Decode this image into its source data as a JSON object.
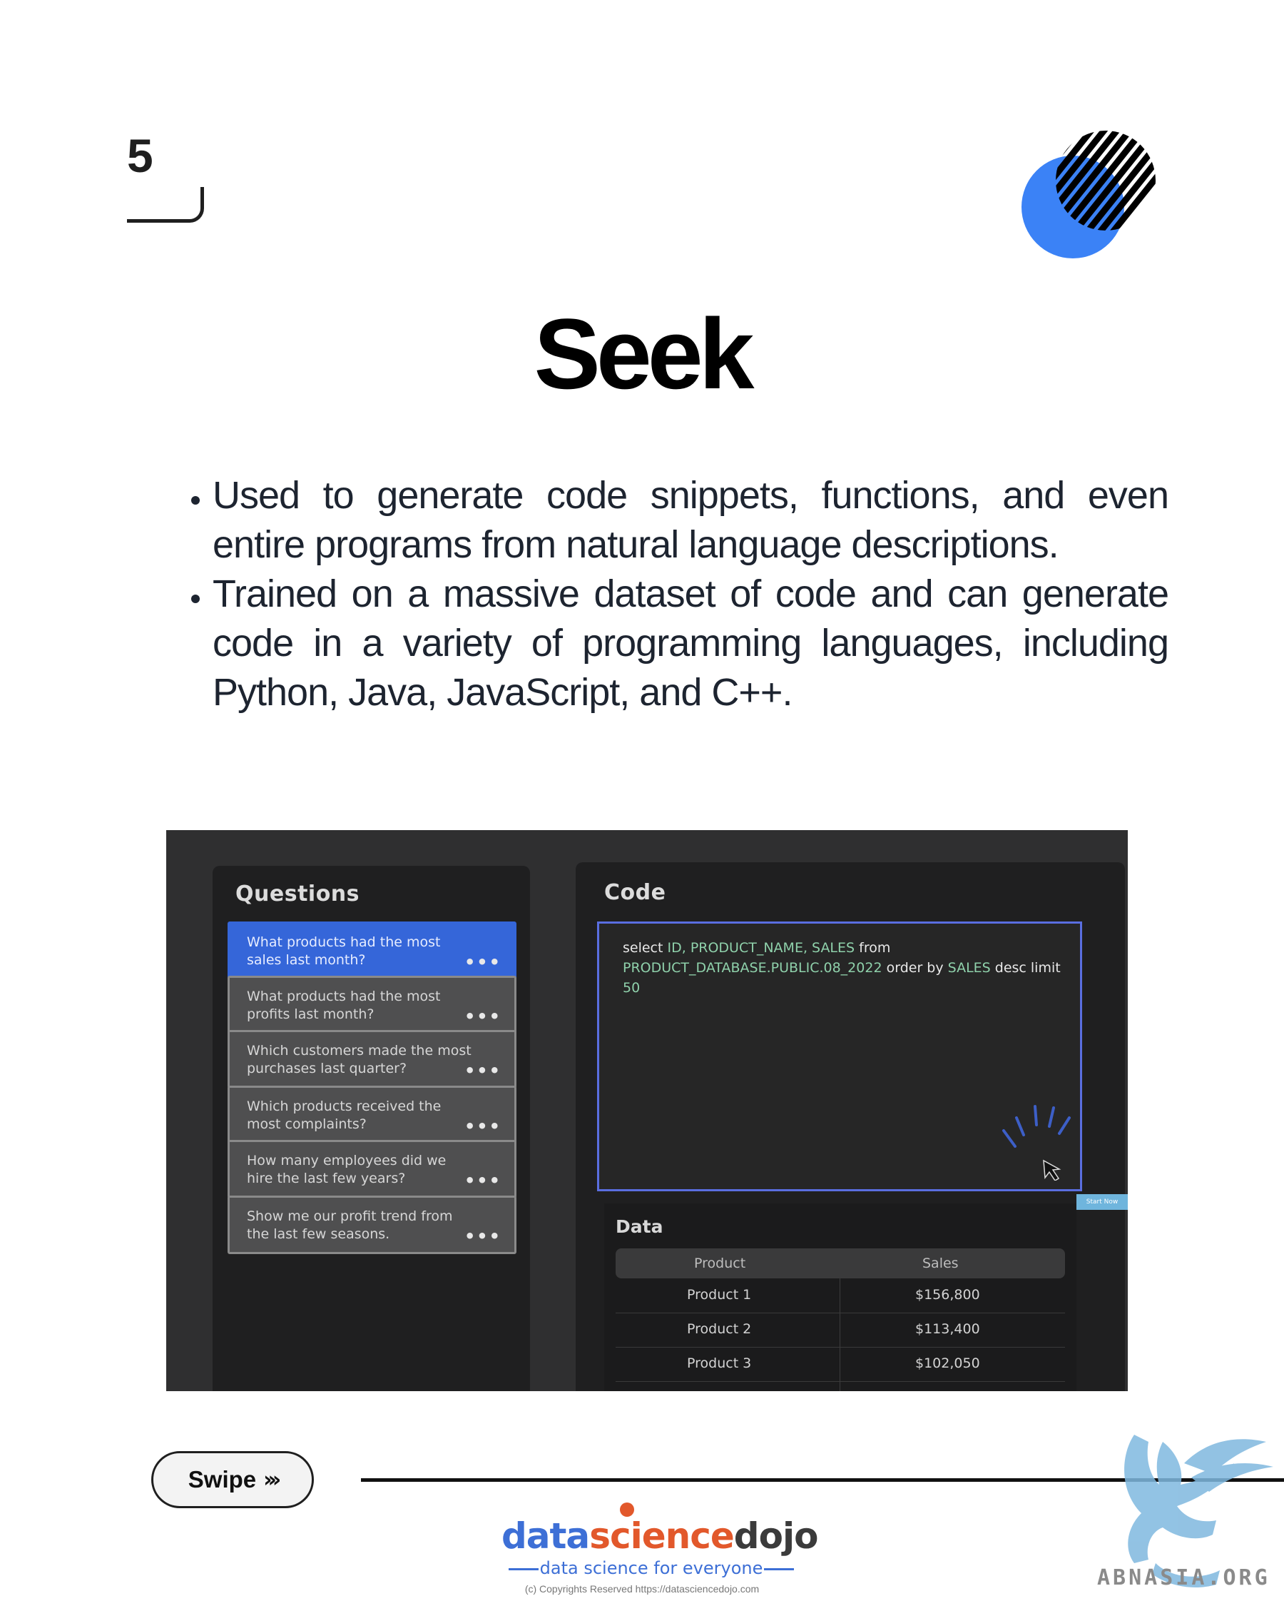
{
  "slide": {
    "number": "5",
    "title": "Seek",
    "bullets": [
      "Used to generate code snippets, functions, and even entire programs from natural language descriptions.",
      "Trained on a massive dataset of code and can generate code in a variety of programming languages, including Python, Java, JavaScript, and C++."
    ]
  },
  "screenshot": {
    "questions_title": "Questions",
    "questions": [
      {
        "text": "What products had the most sales last month?",
        "active": true
      },
      {
        "text": "What products had the most profits last month?",
        "active": false
      },
      {
        "text": "Which customers made the most purchases last quarter?",
        "active": false
      },
      {
        "text": "Which products received the most complaints?",
        "active": false
      },
      {
        "text": "How many employees did we hire the last few years?",
        "active": false
      },
      {
        "text": "Show me our profit trend from the last few seasons.",
        "active": false
      }
    ],
    "more_glyph": "•••",
    "code_title": "Code",
    "code": {
      "select": "select",
      "fields": "ID, PRODUCT_NAME, SALES",
      "from": "from",
      "table": "PRODUCT_DATABASE.PUBLIC.08_2022",
      "order": "order by",
      "order_field": "SALES",
      "desc": "desc limit",
      "limit": "50"
    },
    "tooltip": "Start Now",
    "data_title": "Data",
    "table_headers": [
      "Product",
      "Sales"
    ],
    "table_rows": [
      [
        "Product 1",
        "$156,800"
      ],
      [
        "Product 2",
        "$113,400"
      ],
      [
        "Product 3",
        "$102,050"
      ]
    ]
  },
  "footer": {
    "swipe_label": "Swipe",
    "swipe_icon": "›››",
    "brand_data": "data",
    "brand_science": "science",
    "brand_dojo": "dojo",
    "tagline": "data science for everyone",
    "copyright": "(c) Copyrights Reserved  https://datasciencedojo.com",
    "watermark": "ABNASIA.ORG"
  },
  "colors": {
    "accent_blue": "#3566d9",
    "brand_orange": "#e2582b",
    "circle_blue": "#3b82f6"
  }
}
